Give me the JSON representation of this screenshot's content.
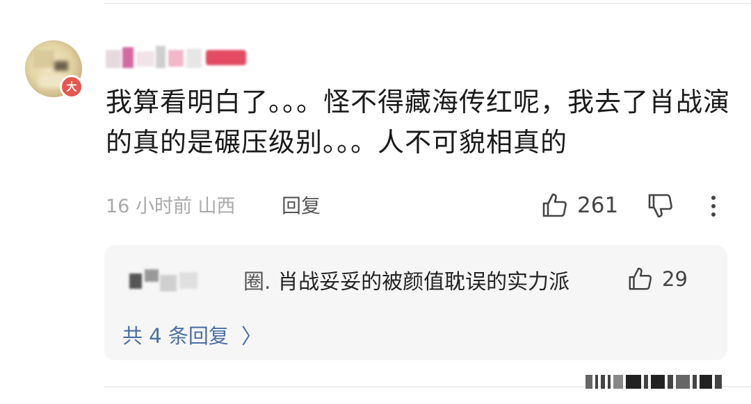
{
  "comment": {
    "text": "我算看明白了。。。怪不得藏海传红呢，我去了肖战演的真的是碾压级别。。。人不可貌相真的",
    "time_location": "16 小时前 山西",
    "reply_label": "回复",
    "like_count": "261",
    "level_badge": "大"
  },
  "top_reply": {
    "username_tail": "圈.",
    "text": "肖战妥妥的被颜值耽误的实力派",
    "like_count": "29"
  },
  "replies_link": {
    "label": "共 4 条回复",
    "chevron": "〉"
  },
  "icons": [
    "like-icon",
    "dislike-icon",
    "more-icon",
    "chevron-right-icon"
  ],
  "colors": {
    "badge": "#e5584f",
    "link": "#4a6fa5",
    "reply_card_bg": "#f6f6f6"
  }
}
